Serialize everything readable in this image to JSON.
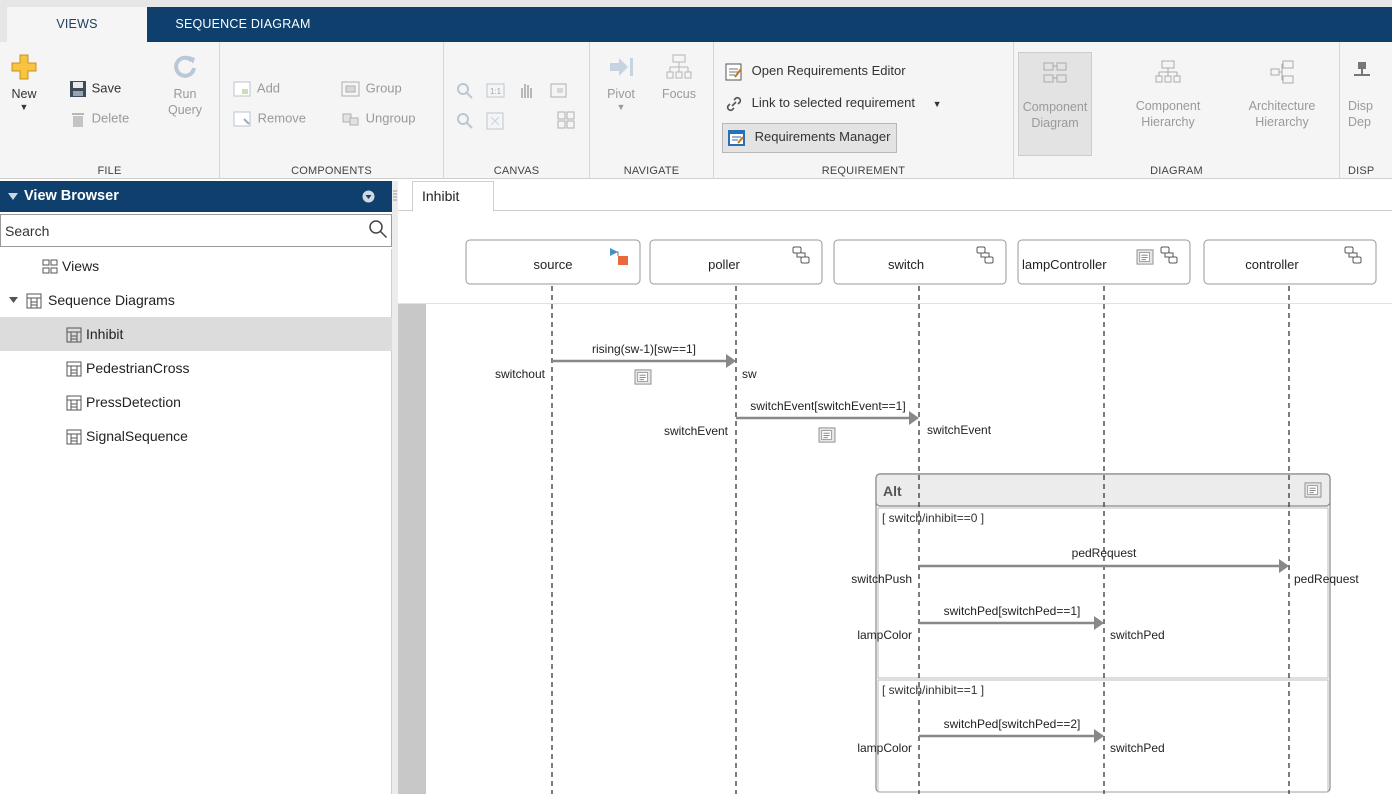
{
  "ribbon_tabs": [
    {
      "label": "VIEWS",
      "active": true
    },
    {
      "label": "SEQUENCE DIAGRAM",
      "active": false
    }
  ],
  "ribbon": {
    "file": {
      "label": "FILE",
      "new": "New",
      "save": "Save",
      "delete": "Delete",
      "run": "Run",
      "query": "Query"
    },
    "components": {
      "label": "COMPONENTS",
      "add": "Add",
      "remove": "Remove",
      "group": "Group",
      "ungroup": "Ungroup"
    },
    "canvas": {
      "label": "CANVAS"
    },
    "navigate": {
      "label": "NAVIGATE",
      "pivot": "Pivot",
      "focus": "Focus"
    },
    "requirement": {
      "label": "REQUIREMENT",
      "open_editor": "Open Requirements Editor",
      "link_selected": "Link to selected requirement",
      "manager": "Requirements Manager"
    },
    "diagram": {
      "label": "DIAGRAM",
      "component_diagram": [
        "Component",
        "Diagram"
      ],
      "component_hierarchy": [
        "Component",
        "Hierarchy"
      ],
      "architecture_hierarchy": [
        "Architecture",
        "Hierarchy"
      ]
    },
    "display": {
      "label": "DISP",
      "line1": "Disp",
      "line2": "Dep"
    }
  },
  "view_browser": {
    "title": "View Browser",
    "search_placeholder": "Search",
    "tree": [
      {
        "label": "Views",
        "level": 1,
        "selected": false,
        "expander": false
      },
      {
        "label": "Sequence Diagrams",
        "level": 1,
        "selected": false,
        "expander": true
      },
      {
        "label": "Inhibit",
        "level": 2,
        "selected": true
      },
      {
        "label": "PedestrianCross",
        "level": 2,
        "selected": false
      },
      {
        "label": "PressDetection",
        "level": 2,
        "selected": false
      },
      {
        "label": "SignalSequence",
        "level": 2,
        "selected": false
      }
    ]
  },
  "editor": {
    "tab": "Inhibit",
    "lifelines": [
      "source",
      "poller",
      "switch",
      "lampController",
      "controller"
    ],
    "messages": [
      {
        "label": "rising(sw-1)[sw==1]",
        "src_port": "switchout",
        "dst_port": "sw"
      },
      {
        "label": "switchEvent[switchEvent==1]",
        "src_port": "switchEvent",
        "dst_port": "switchEvent"
      },
      {
        "label": "pedRequest",
        "src_port": "switchPush",
        "dst_port": "pedRequest"
      },
      {
        "label": "switchPed[switchPed==1]",
        "src_port": "lampColor",
        "dst_port": "switchPed"
      },
      {
        "label": "switchPed[switchPed==2]",
        "src_port": "lampColor",
        "dst_port": "switchPed"
      }
    ],
    "fragment": {
      "label": "Alt",
      "operands": [
        "[ switch/inhibit==0 ]",
        "[ switch/inhibit==1 ]"
      ]
    }
  }
}
